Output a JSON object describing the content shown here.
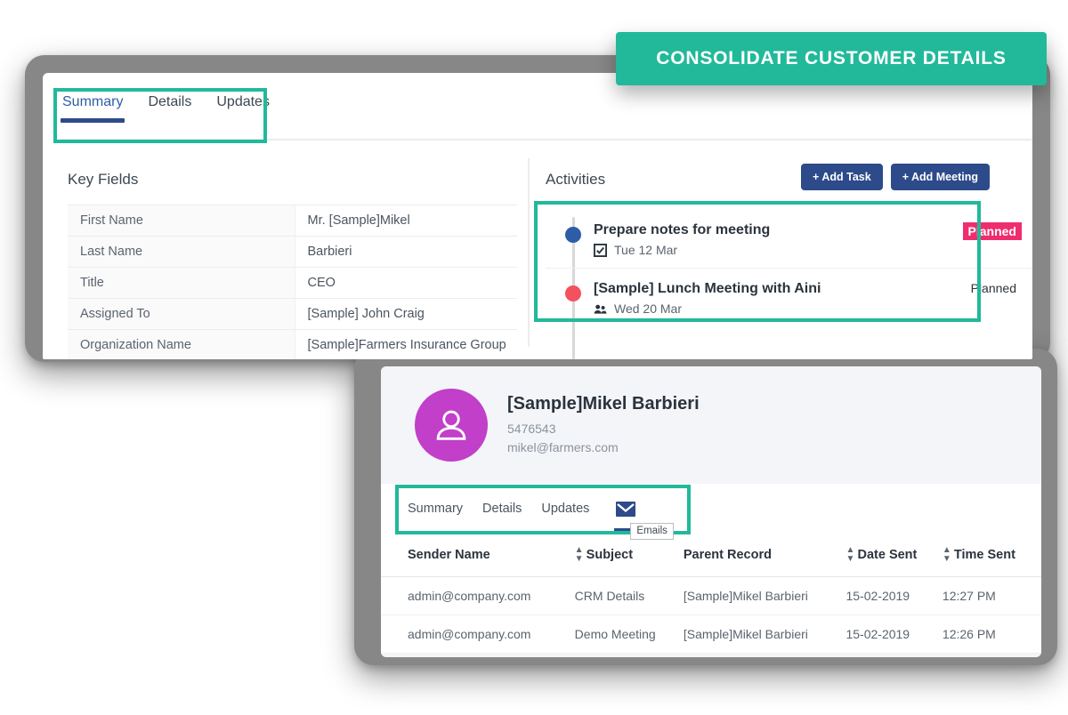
{
  "banner": {
    "text": "CONSOLIDATE CUSTOMER DETAILS",
    "color": "#21b99a"
  },
  "colors": {
    "teal": "#21b99a",
    "navy": "#2d4a8a",
    "pink": "#ef2d6e",
    "avatar_magenta": "#c13fc9",
    "dot_blue": "#2e5da8",
    "dot_red": "#f4515e",
    "frame_gray": "#878787"
  },
  "top_panel": {
    "tabs": [
      {
        "label": "Summary",
        "active": true
      },
      {
        "label": "Details",
        "active": false
      },
      {
        "label": "Updates",
        "active": false
      }
    ],
    "key_fields": {
      "title": "Key Fields",
      "rows": [
        {
          "label": "First Name",
          "value": "Mr. [Sample]Mikel"
        },
        {
          "label": "Last Name",
          "value": "Barbieri"
        },
        {
          "label": "Title",
          "value": "CEO"
        },
        {
          "label": "Assigned To",
          "value": "[Sample] John Craig"
        },
        {
          "label": "Organization Name",
          "value": "[Sample]Farmers Insurance Group"
        }
      ]
    },
    "activities": {
      "title": "Activities",
      "add_task_label": "+ Add Task",
      "add_meeting_label": "+ Add Meeting",
      "items": [
        {
          "title": "Prepare notes for meeting",
          "date": "Tue 12 Mar",
          "icon": "checkbox-checked-icon",
          "status": "Planned",
          "status_highlighted": true,
          "dot": "blue"
        },
        {
          "title": "[Sample] Lunch Meeting with Aini",
          "date": "Wed 20 Mar",
          "icon": "people-icon",
          "status": "Planned",
          "status_highlighted": false,
          "dot": "red"
        }
      ]
    }
  },
  "bottom_panel": {
    "contact": {
      "name": "[Sample]Mikel Barbieri",
      "phone": "5476543",
      "email": "mikel@farmers.com",
      "avatar_icon": "person-icon"
    },
    "tabs": [
      {
        "label": "Summary",
        "active": false
      },
      {
        "label": "Details",
        "active": false
      },
      {
        "label": "Updates",
        "active": false
      }
    ],
    "mail_tab": {
      "icon": "envelope-icon",
      "tooltip": "Emails"
    },
    "emails_table": {
      "columns": [
        {
          "label": "Sender Name",
          "sortable": false
        },
        {
          "label": "Subject",
          "sortable": true
        },
        {
          "label": "Parent Record",
          "sortable": false
        },
        {
          "label": "Date Sent",
          "sortable": true
        },
        {
          "label": "Time Sent",
          "sortable": true
        }
      ],
      "rows": [
        {
          "sender": "admin@company.com",
          "subject": "CRM Details",
          "parent": "[Sample]Mikel Barbieri",
          "date": "15-02-2019",
          "time": "12:27 PM"
        },
        {
          "sender": "admin@company.com",
          "subject": "Demo Meeting",
          "parent": "[Sample]Mikel Barbieri",
          "date": "15-02-2019",
          "time": "12:26 PM"
        }
      ]
    }
  }
}
